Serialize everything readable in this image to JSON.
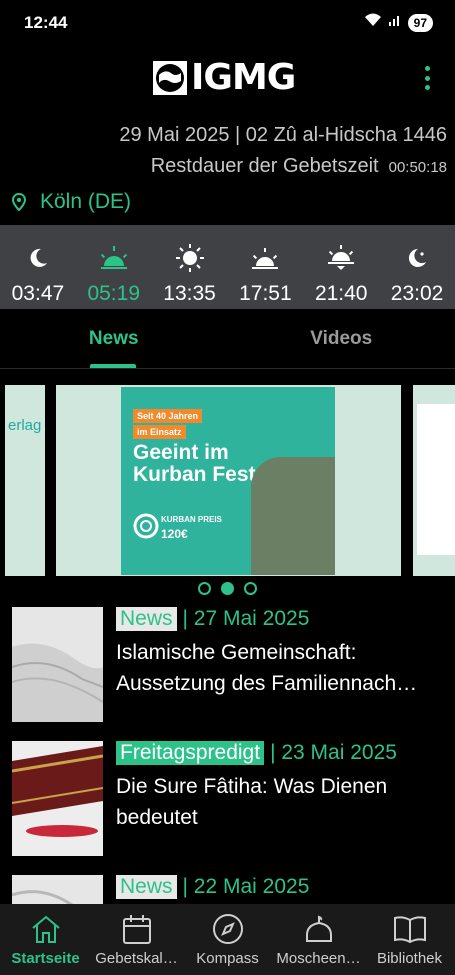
{
  "status_bar": {
    "time": "12:44",
    "battery": "97"
  },
  "header": {
    "logo_text": "IGMG"
  },
  "date": {
    "gregorian_hijri": "29 Mai 2025 | 02 Zû al-Hidscha 1446",
    "remaining_label": "Restdauer der Gebetszeit",
    "remaining_value": "00:50:18"
  },
  "location": {
    "name": "Köln (DE)"
  },
  "prayer_times": [
    {
      "icon": "crescent-moon-icon",
      "time": "03:47",
      "active": false
    },
    {
      "icon": "sunrise-icon",
      "time": "05:19",
      "active": true
    },
    {
      "icon": "sun-icon",
      "time": "13:35",
      "active": false
    },
    {
      "icon": "half-sun-icon",
      "time": "17:51",
      "active": false
    },
    {
      "icon": "sunset-icon",
      "time": "21:40",
      "active": false
    },
    {
      "icon": "moon-star-icon",
      "time": "23:02",
      "active": false
    }
  ],
  "tabs": [
    {
      "label": "News",
      "active": true
    },
    {
      "label": "Videos",
      "active": false
    }
  ],
  "carousel": {
    "left_slide_text": "erlag",
    "banner": {
      "tag_line1": "Seit 40 Jahren",
      "tag_line2": "im Einsatz",
      "title_line1": "Geeint im",
      "title_line2": "Kurban Fest",
      "price_label": "KURBAN PREIS",
      "price_value": "120€"
    },
    "dots_count": 3,
    "active_dot": 1
  },
  "news": [
    {
      "category": "News",
      "date": "| 27 Mai 2025",
      "title": "Islamische Gemeinschaft: Aussetzung des Familiennach…"
    },
    {
      "category": "Freitagspredigt",
      "date": "| 23 Mai 2025",
      "title": "Die Sure Fâtiha: Was Dienen bedeutet"
    },
    {
      "category": "News",
      "date": "| 22 Mai 2025",
      "title": ""
    }
  ],
  "bottom_nav": [
    {
      "icon": "home-icon",
      "label": "Startseite",
      "active": true
    },
    {
      "icon": "calendar-icon",
      "label": "Gebetskal…",
      "active": false
    },
    {
      "icon": "compass-icon",
      "label": "Kompass",
      "active": false
    },
    {
      "icon": "mosque-icon",
      "label": "Moscheen…",
      "active": false
    },
    {
      "icon": "book-icon",
      "label": "Bibliothek",
      "active": false
    }
  ],
  "colors": {
    "accent": "#2dc28a",
    "background": "#000000",
    "prayer_bar": "#3f4144"
  }
}
